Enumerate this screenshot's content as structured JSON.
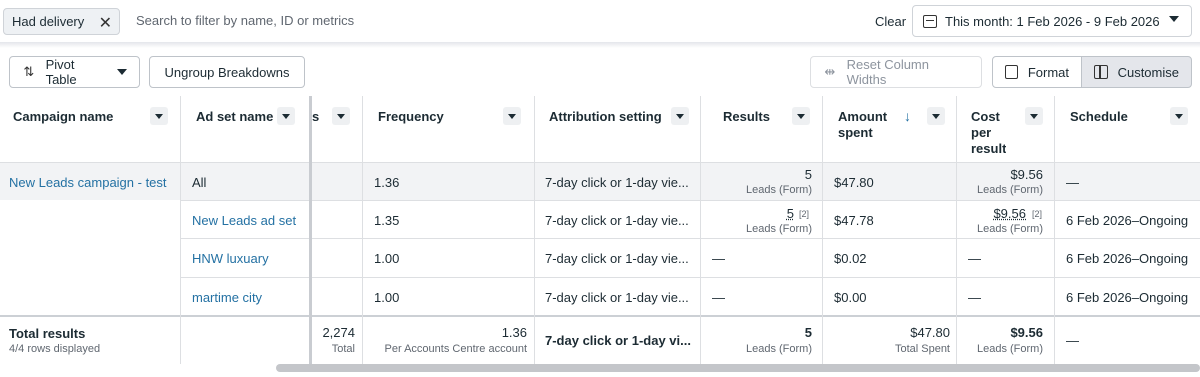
{
  "filter": {
    "chip_label": "Had delivery",
    "search_placeholder": "Search to filter by name, ID or metrics",
    "clear_label": "Clear",
    "date_range": "This month: 1 Feb 2026 - 9 Feb 2026"
  },
  "toolbar": {
    "pivot_label": "Pivot Table",
    "ungroup_label": "Ungroup Breakdowns",
    "reset_label": "Reset Column Widths",
    "format_label": "Format",
    "customise_label": "Customise"
  },
  "columns": {
    "campaign": "Campaign name",
    "adset": "Ad set name",
    "reach_partial": "s",
    "frequency": "Frequency",
    "attribution": "Attribution setting",
    "results": "Results",
    "amount_l1": "Amount",
    "amount_l2": "spent",
    "sort_arrow": "↓",
    "cost_l1": "Cost",
    "cost_l2": "per",
    "cost_l3": "result",
    "schedule": "Schedule"
  },
  "rows": [
    {
      "campaign": "New Leads campaign - test",
      "adset": "All",
      "frequency": "1.36",
      "attribution": "7-day click or 1-day vie...",
      "results": "5",
      "results_sub": "Leads (Form)",
      "results_note": "",
      "amount": "$47.80",
      "cost": "$9.56",
      "cost_sub": "Leads (Form)",
      "cost_note": "",
      "schedule": "—"
    },
    {
      "campaign": "",
      "adset": "New Leads ad set",
      "frequency": "1.35",
      "attribution": "7-day click or 1-day vie...",
      "results": "5",
      "results_sub": "Leads (Form)",
      "results_note": "[2]",
      "amount": "$47.78",
      "cost": "$9.56",
      "cost_sub": "Leads (Form)",
      "cost_note": "[2]",
      "schedule": "6 Feb 2026–Ongoing"
    },
    {
      "campaign": "",
      "adset": "HNW luxuary",
      "frequency": "1.00",
      "attribution": "7-day click or 1-day vie...",
      "results": "—",
      "results_sub": "",
      "results_note": "",
      "amount": "$0.02",
      "cost": "—",
      "cost_sub": "",
      "cost_note": "",
      "schedule": "6 Feb 2026–Ongoing"
    },
    {
      "campaign": "",
      "adset": "martime city",
      "frequency": "1.00",
      "attribution": "7-day click or 1-day vie...",
      "results": "—",
      "results_sub": "",
      "results_note": "",
      "amount": "$0.00",
      "cost": "—",
      "cost_sub": "",
      "cost_note": "",
      "schedule": "6 Feb 2026–Ongoing"
    }
  ],
  "totals": {
    "label": "Total results",
    "rows_displayed": "4/4 rows displayed",
    "reach": "2,274",
    "reach_sub": "Total",
    "frequency": "1.36",
    "frequency_sub": "Per Accounts Centre account",
    "attribution": "7-day click or 1-day vi...",
    "results": "5",
    "results_sub": "Leads (Form)",
    "amount": "$47.80",
    "amount_sub": "Total Spent",
    "cost": "$9.56",
    "cost_sub": "Leads (Form)",
    "schedule": "—"
  },
  "colors": {
    "link": "#2471a3",
    "selected_row": "#f2f3f5"
  }
}
